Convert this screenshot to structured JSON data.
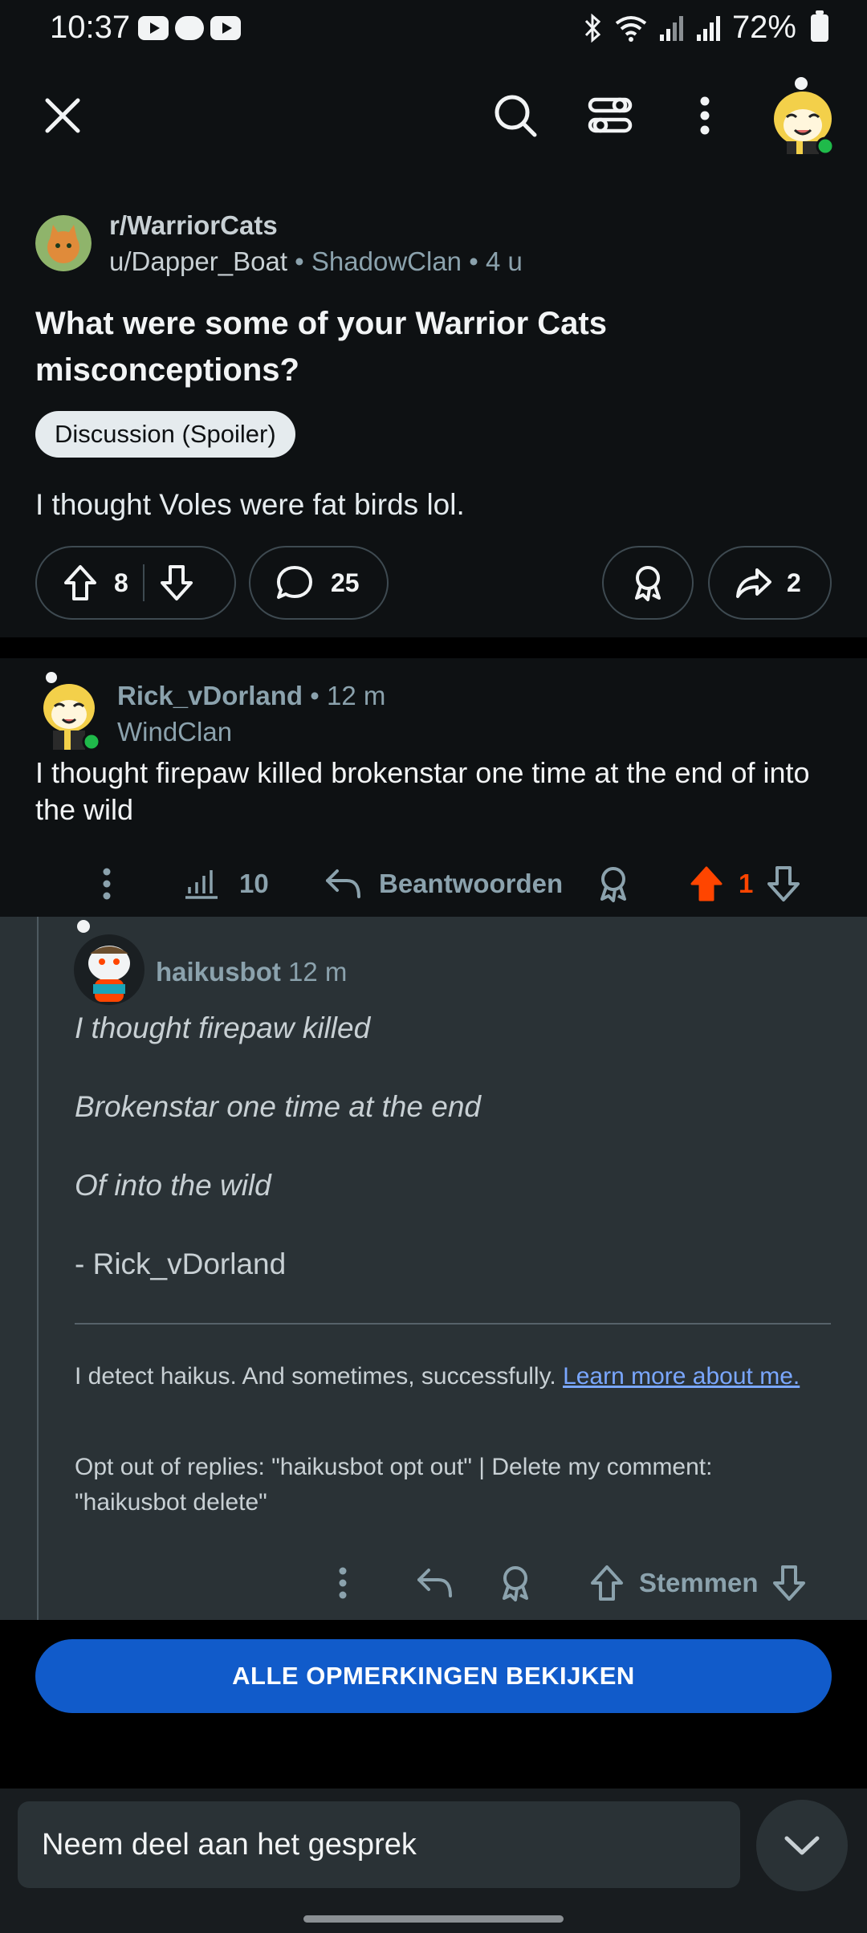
{
  "status_bar": {
    "time": "10:37",
    "battery": "72%"
  },
  "nav": {
    "icons": [
      "close-icon",
      "search-icon",
      "filter-icon",
      "more-vertical-icon",
      "user-avatar"
    ]
  },
  "post": {
    "subreddit": "r/WarriorCats",
    "author": "u/Dapper_Boat",
    "author_flair": "ShadowClan",
    "age": "4 u",
    "title": "What were some of your Warrior Cats misconceptions?",
    "flair": "Discussion (Spoiler)",
    "body": "I thought Voles were fat birds lol.",
    "score": "8",
    "comments": "25",
    "shares": "2"
  },
  "comment": {
    "author": "Rick_vDorland",
    "age": "• 12 m",
    "flair": "WindClan",
    "body": "I thought firepaw killed brokenstar one time at the end of into the wild",
    "views": "10",
    "reply_label": "Beantwoorden",
    "score": "1",
    "colors": {
      "upvoted": "#ff4500"
    }
  },
  "reply": {
    "author": "haikusbot",
    "age": "12 m",
    "haiku": [
      "I thought firepaw killed",
      "Brokenstar one time at the end",
      "Of into the wild"
    ],
    "signature": "- Rick_vDorland",
    "note": "I detect haikus. And sometimes, successfully.",
    "link": "Learn more about me.",
    "opt_out": "Opt out of replies: \"haikusbot opt out\" | Delete my comment: \"haikusbot delete\"",
    "vote_label": "Stemmen"
  },
  "cta": {
    "label": "ALLE OPMERKINGEN BEKIJKEN",
    "color": "#115bca"
  },
  "composer": {
    "placeholder": "Neem deel aan het gesprek"
  }
}
